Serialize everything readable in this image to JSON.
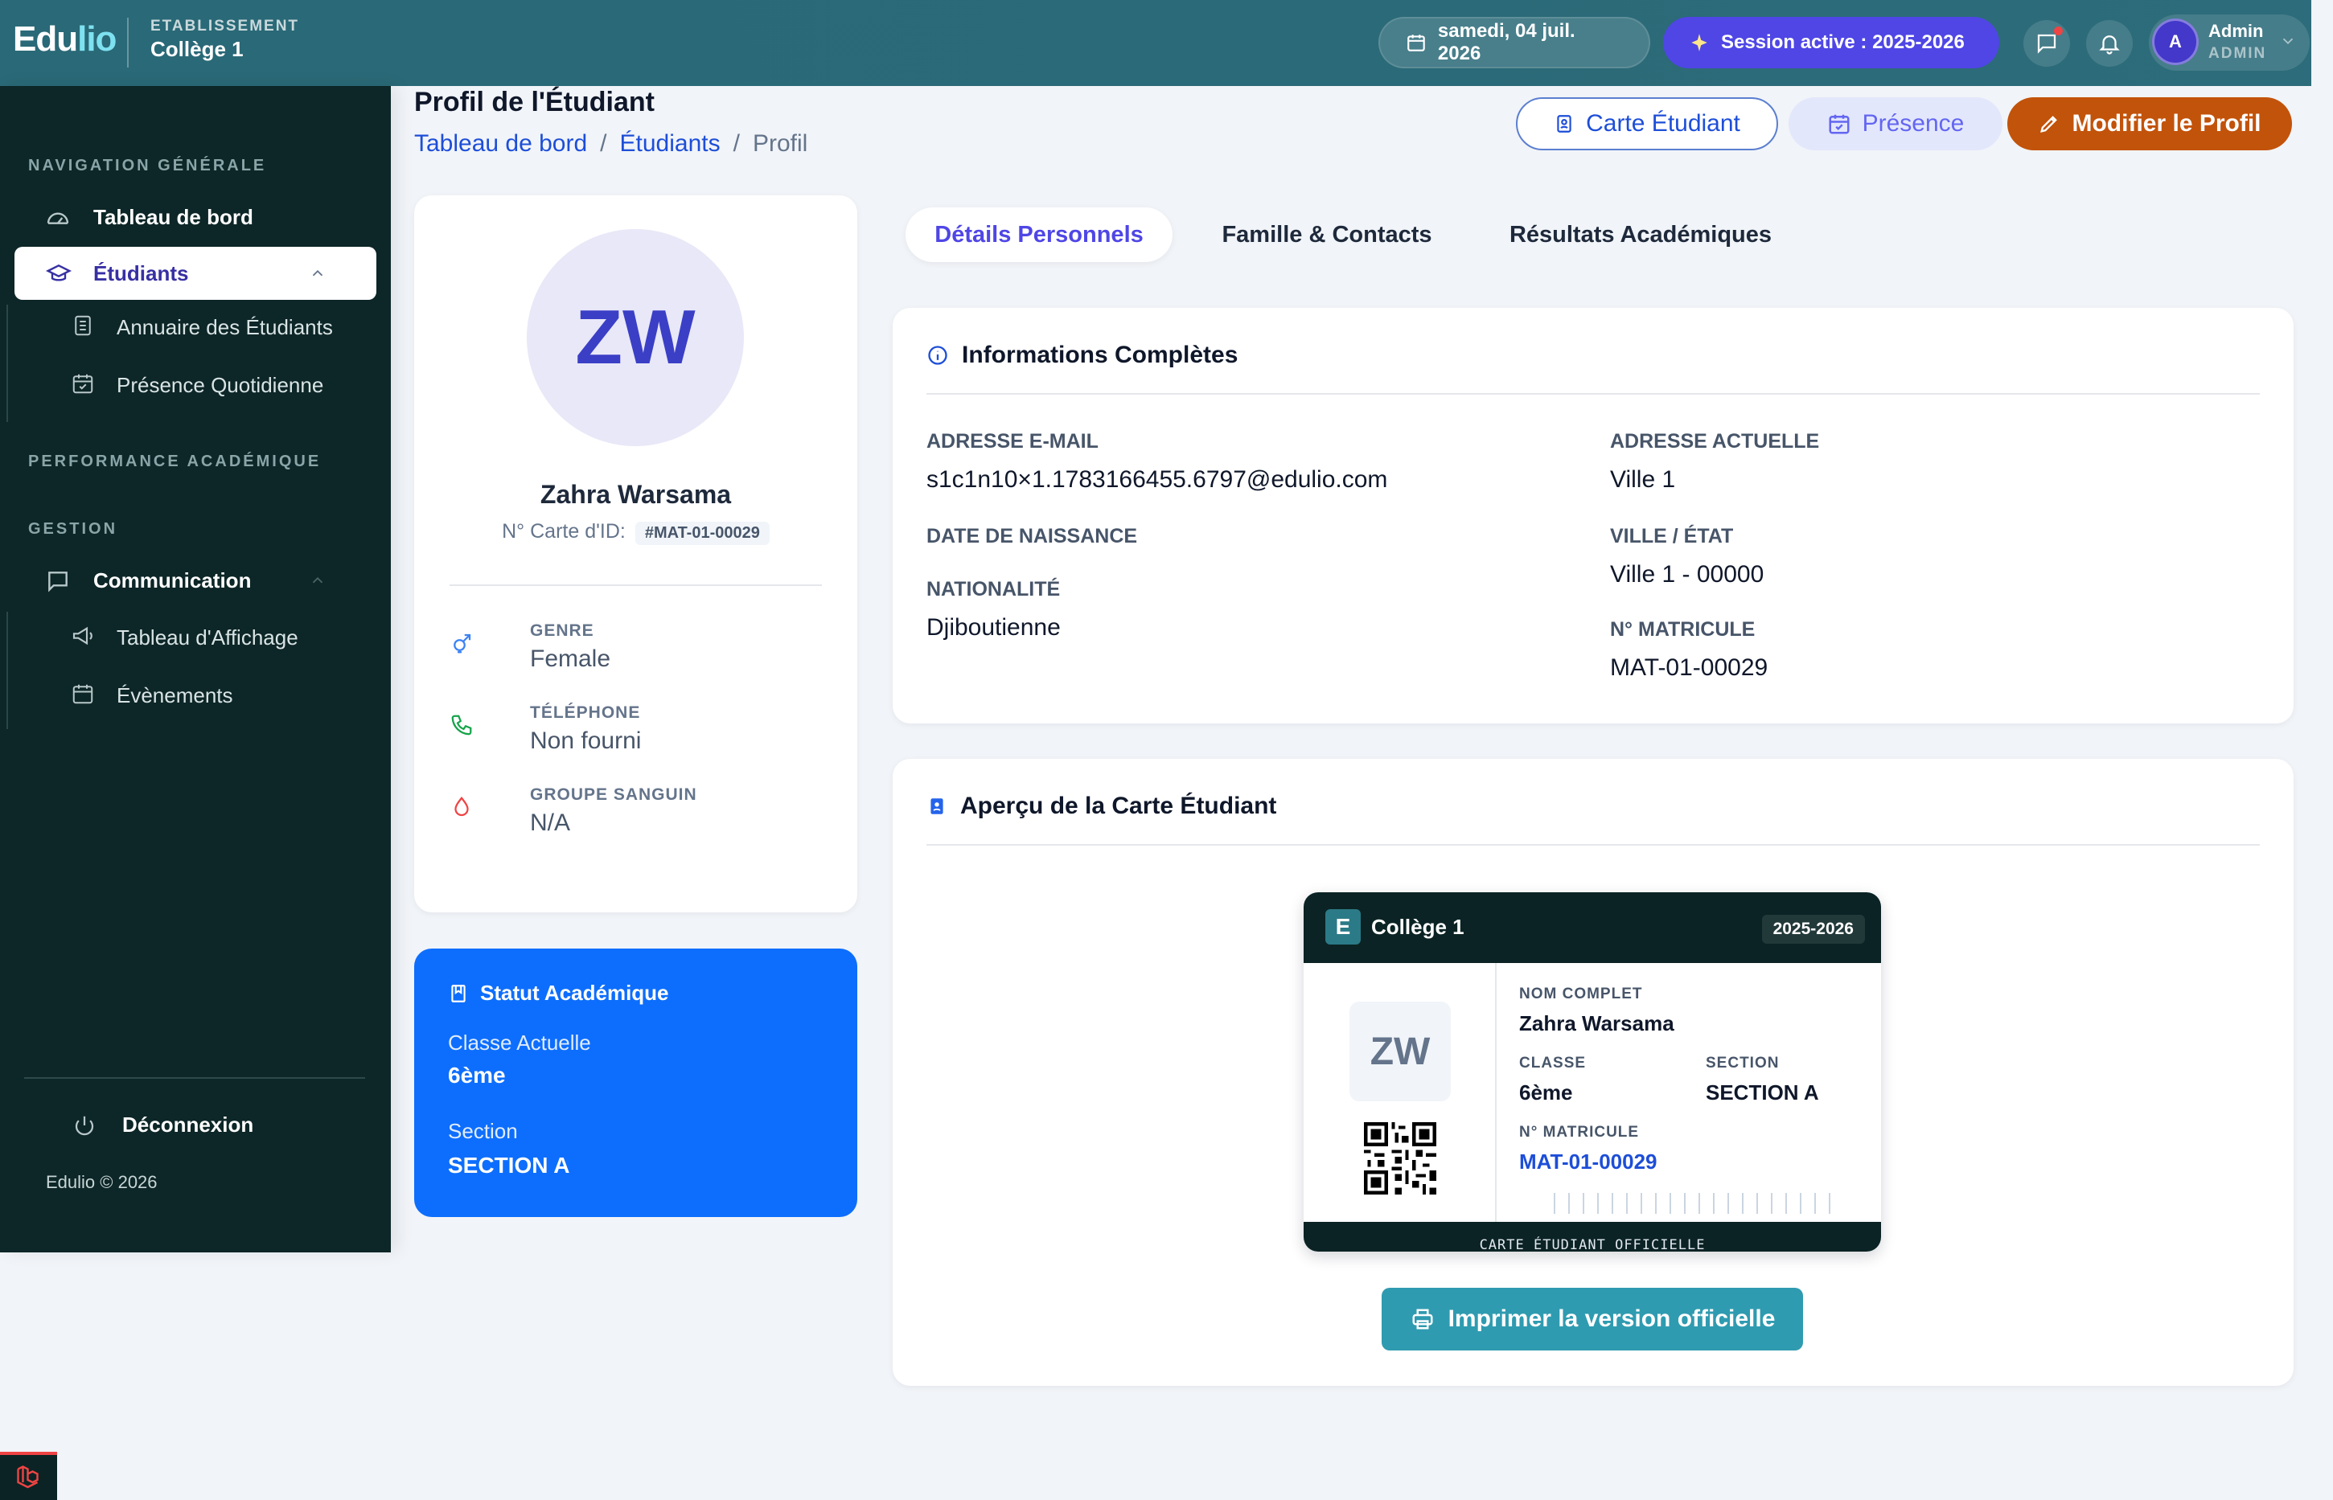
{
  "topbar": {
    "logo_main": "Edu",
    "logo_accent": "lio",
    "etablissement_kicker": "ETABLISSEMENT",
    "etablissement_name": "Collège 1",
    "date": "samedi, 04 juil. 2026",
    "session": "Session active : 2025-2026",
    "admin_initial": "A",
    "admin_name": "Admin",
    "admin_role": "ADMIN"
  },
  "sidebar": {
    "section_nav": "NAVIGATION GÉNÉRALE",
    "dashboard": "Tableau de bord",
    "students": "Étudiants",
    "students_sub": [
      "Annuaire des Étudiants",
      "Présence Quotidienne"
    ],
    "section_perf": "PERFORMANCE ACADÉMIQUE",
    "section_gestion": "GESTION",
    "communication": "Communication",
    "communication_sub": [
      "Tableau d'Affichage",
      "Évènements"
    ],
    "logout": "Déconnexion",
    "copyright": "Edulio © 2026"
  },
  "header": {
    "title": "Profil de l'Étudiant",
    "breadcrumb": [
      "Tableau de bord",
      "Étudiants",
      "Profil"
    ],
    "separator": "/",
    "btn_card": "Carte Étudiant",
    "btn_presence": "Présence",
    "btn_edit": "Modifier le Profil"
  },
  "profile": {
    "initials": "ZW",
    "name": "Zahra Warsama",
    "id_label": "N° Carte d'ID:",
    "id_value": "#MAT-01-00029",
    "gender_label": "GENRE",
    "gender": "Female",
    "phone_label": "TÉLÉPHONE",
    "phone": "Non fourni",
    "blood_label": "GROUPE SANGUIN",
    "blood": "N/A"
  },
  "academic_status": {
    "title": "Statut Académique",
    "class_label": "Classe Actuelle",
    "class": "6ème",
    "section_label": "Section",
    "section": "SECTION A"
  },
  "tabs": [
    "Détails Personnels",
    "Famille & Contacts",
    "Résultats Académiques"
  ],
  "info": {
    "title": "Informations Complètes",
    "email_label": "ADRESSE E-MAIL",
    "email": "s1c1n10×1.1783166455.6797@edulio.com",
    "birth_label": "DATE DE NAISSANCE",
    "nationality_label": "NATIONALITÉ",
    "nationality": "Djiboutienne",
    "address_label": "ADRESSE ACTUELLE",
    "address": "Ville 1",
    "city_label": "VILLE / ÉTAT",
    "city": "Ville 1 - 00000",
    "matricule_label": "N° MATRICULE",
    "matricule": "MAT-01-00029"
  },
  "card_preview": {
    "title": "Aperçu de la Carte Étudiant",
    "logo_letter": "E",
    "school": "Collège 1",
    "year": "2025-2026",
    "initials": "ZW",
    "name_label": "NOM COMPLET",
    "name": "Zahra Warsama",
    "class_label": "CLASSE",
    "class": "6ème",
    "section_label": "SECTION",
    "section": "SECTION A",
    "matricule_label": "N° MATRICULE",
    "matricule": "MAT-01-00029",
    "footer": "CARTE ÉTUDIANT OFFICIELLE",
    "print_button": "Imprimer la version officielle"
  }
}
